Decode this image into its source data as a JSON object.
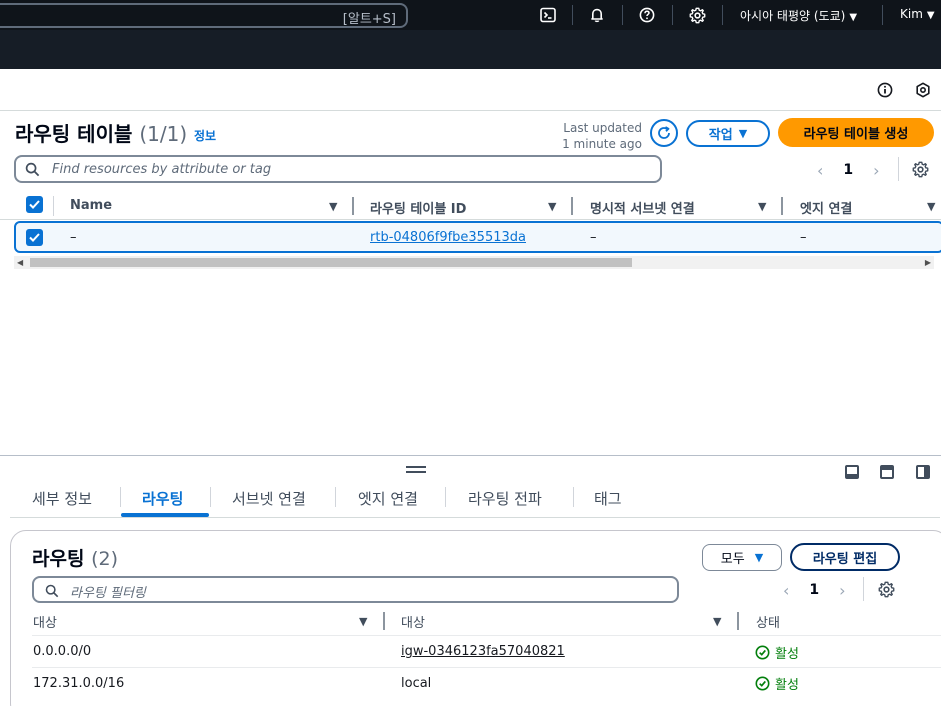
{
  "topnav": {
    "search_shortcut": "[알트+S]",
    "region": "아시아 태평양 (도쿄)",
    "user": "Kim"
  },
  "route_tables": {
    "title": "라우팅 테이블",
    "count": "(1/1)",
    "info": "정보",
    "last_updated_line1": "Last updated",
    "last_updated_line2": "1 minute ago",
    "actions_label": "작업",
    "create_label": "라우팅 테이블 생성",
    "filter_placeholder": "Find resources by attribute or tag",
    "page": "1",
    "columns": [
      "Name",
      "라우팅 테이블 ID",
      "명시적 서브넷 연결",
      "엣지 연결"
    ],
    "rows": [
      {
        "name": "–",
        "id": "rtb-04806f9fbe35513da",
        "explicit_subnet": "–",
        "edge": "–"
      }
    ]
  },
  "detail_panel": {
    "tabs": [
      "세부 정보",
      "라우팅",
      "서브넷 연결",
      "엣지 연결",
      "라우팅 전파",
      "태그"
    ],
    "active_tab": "라우팅",
    "routes": {
      "title": "라우팅",
      "count": "(2)",
      "filter_select": "모두",
      "edit_label": "라우팅 편집",
      "filter_placeholder": "라우팅 필터링",
      "page": "1",
      "columns": [
        "대상",
        "대상",
        "상태"
      ],
      "rows": [
        {
          "destination": "0.0.0.0/0",
          "target": "igw-0346123fa57040821",
          "status": "활성"
        },
        {
          "destination": "172.31.0.0/16",
          "target": "local",
          "status": "활성"
        }
      ]
    }
  },
  "colors": {
    "accent": "#0972d3",
    "primary_button": "#ff9900",
    "success": "#037f0c",
    "nav_bg": "#0f141a"
  }
}
